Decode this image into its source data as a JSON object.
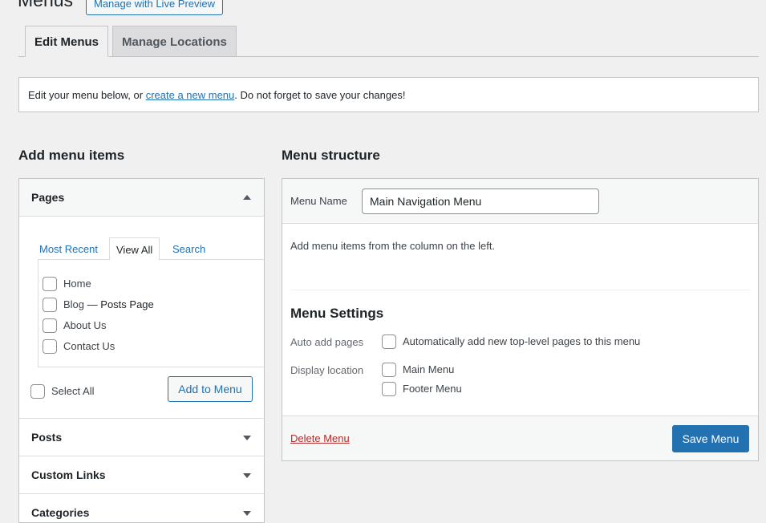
{
  "header": {
    "title": "Menus",
    "live_preview_label": "Manage with Live Preview"
  },
  "tabs": [
    {
      "label": "Edit Menus",
      "active": true
    },
    {
      "label": "Manage Locations",
      "active": false
    }
  ],
  "notice": {
    "prefix": "Edit your menu below, or ",
    "link": "create a new menu",
    "suffix": ". Do not forget to save your changes!"
  },
  "left": {
    "title": "Add menu items",
    "sections": [
      {
        "label": "Pages",
        "expanded": true
      },
      {
        "label": "Posts",
        "expanded": false
      },
      {
        "label": "Custom Links",
        "expanded": false
      },
      {
        "label": "Categories",
        "expanded": false
      }
    ],
    "page_tabs": [
      "Most Recent",
      "View All",
      "Search"
    ],
    "active_page_tab": "View All",
    "pages": [
      {
        "label": "Home"
      },
      {
        "label": "Blog",
        "suffix": "— Posts Page"
      },
      {
        "label": "About Us"
      },
      {
        "label": "Contact Us"
      }
    ],
    "select_all_label": "Select All",
    "add_button_label": "Add to Menu"
  },
  "right": {
    "title": "Menu structure",
    "menu_name_label": "Menu Name",
    "menu_name_value": "Main Navigation Menu",
    "help_text": "Add menu items from the column on the left.",
    "settings_title": "Menu Settings",
    "auto_add_label": "Auto add pages",
    "auto_add_option": "Automatically add new top-level pages to this menu",
    "display_location_label": "Display location",
    "locations": [
      "Main Menu",
      "Footer Menu"
    ],
    "delete_label": "Delete Menu",
    "save_label": "Save Menu"
  },
  "colors": {
    "accent": "#2271b1",
    "danger": "#b32d2e",
    "background": "#f0f0f1"
  }
}
